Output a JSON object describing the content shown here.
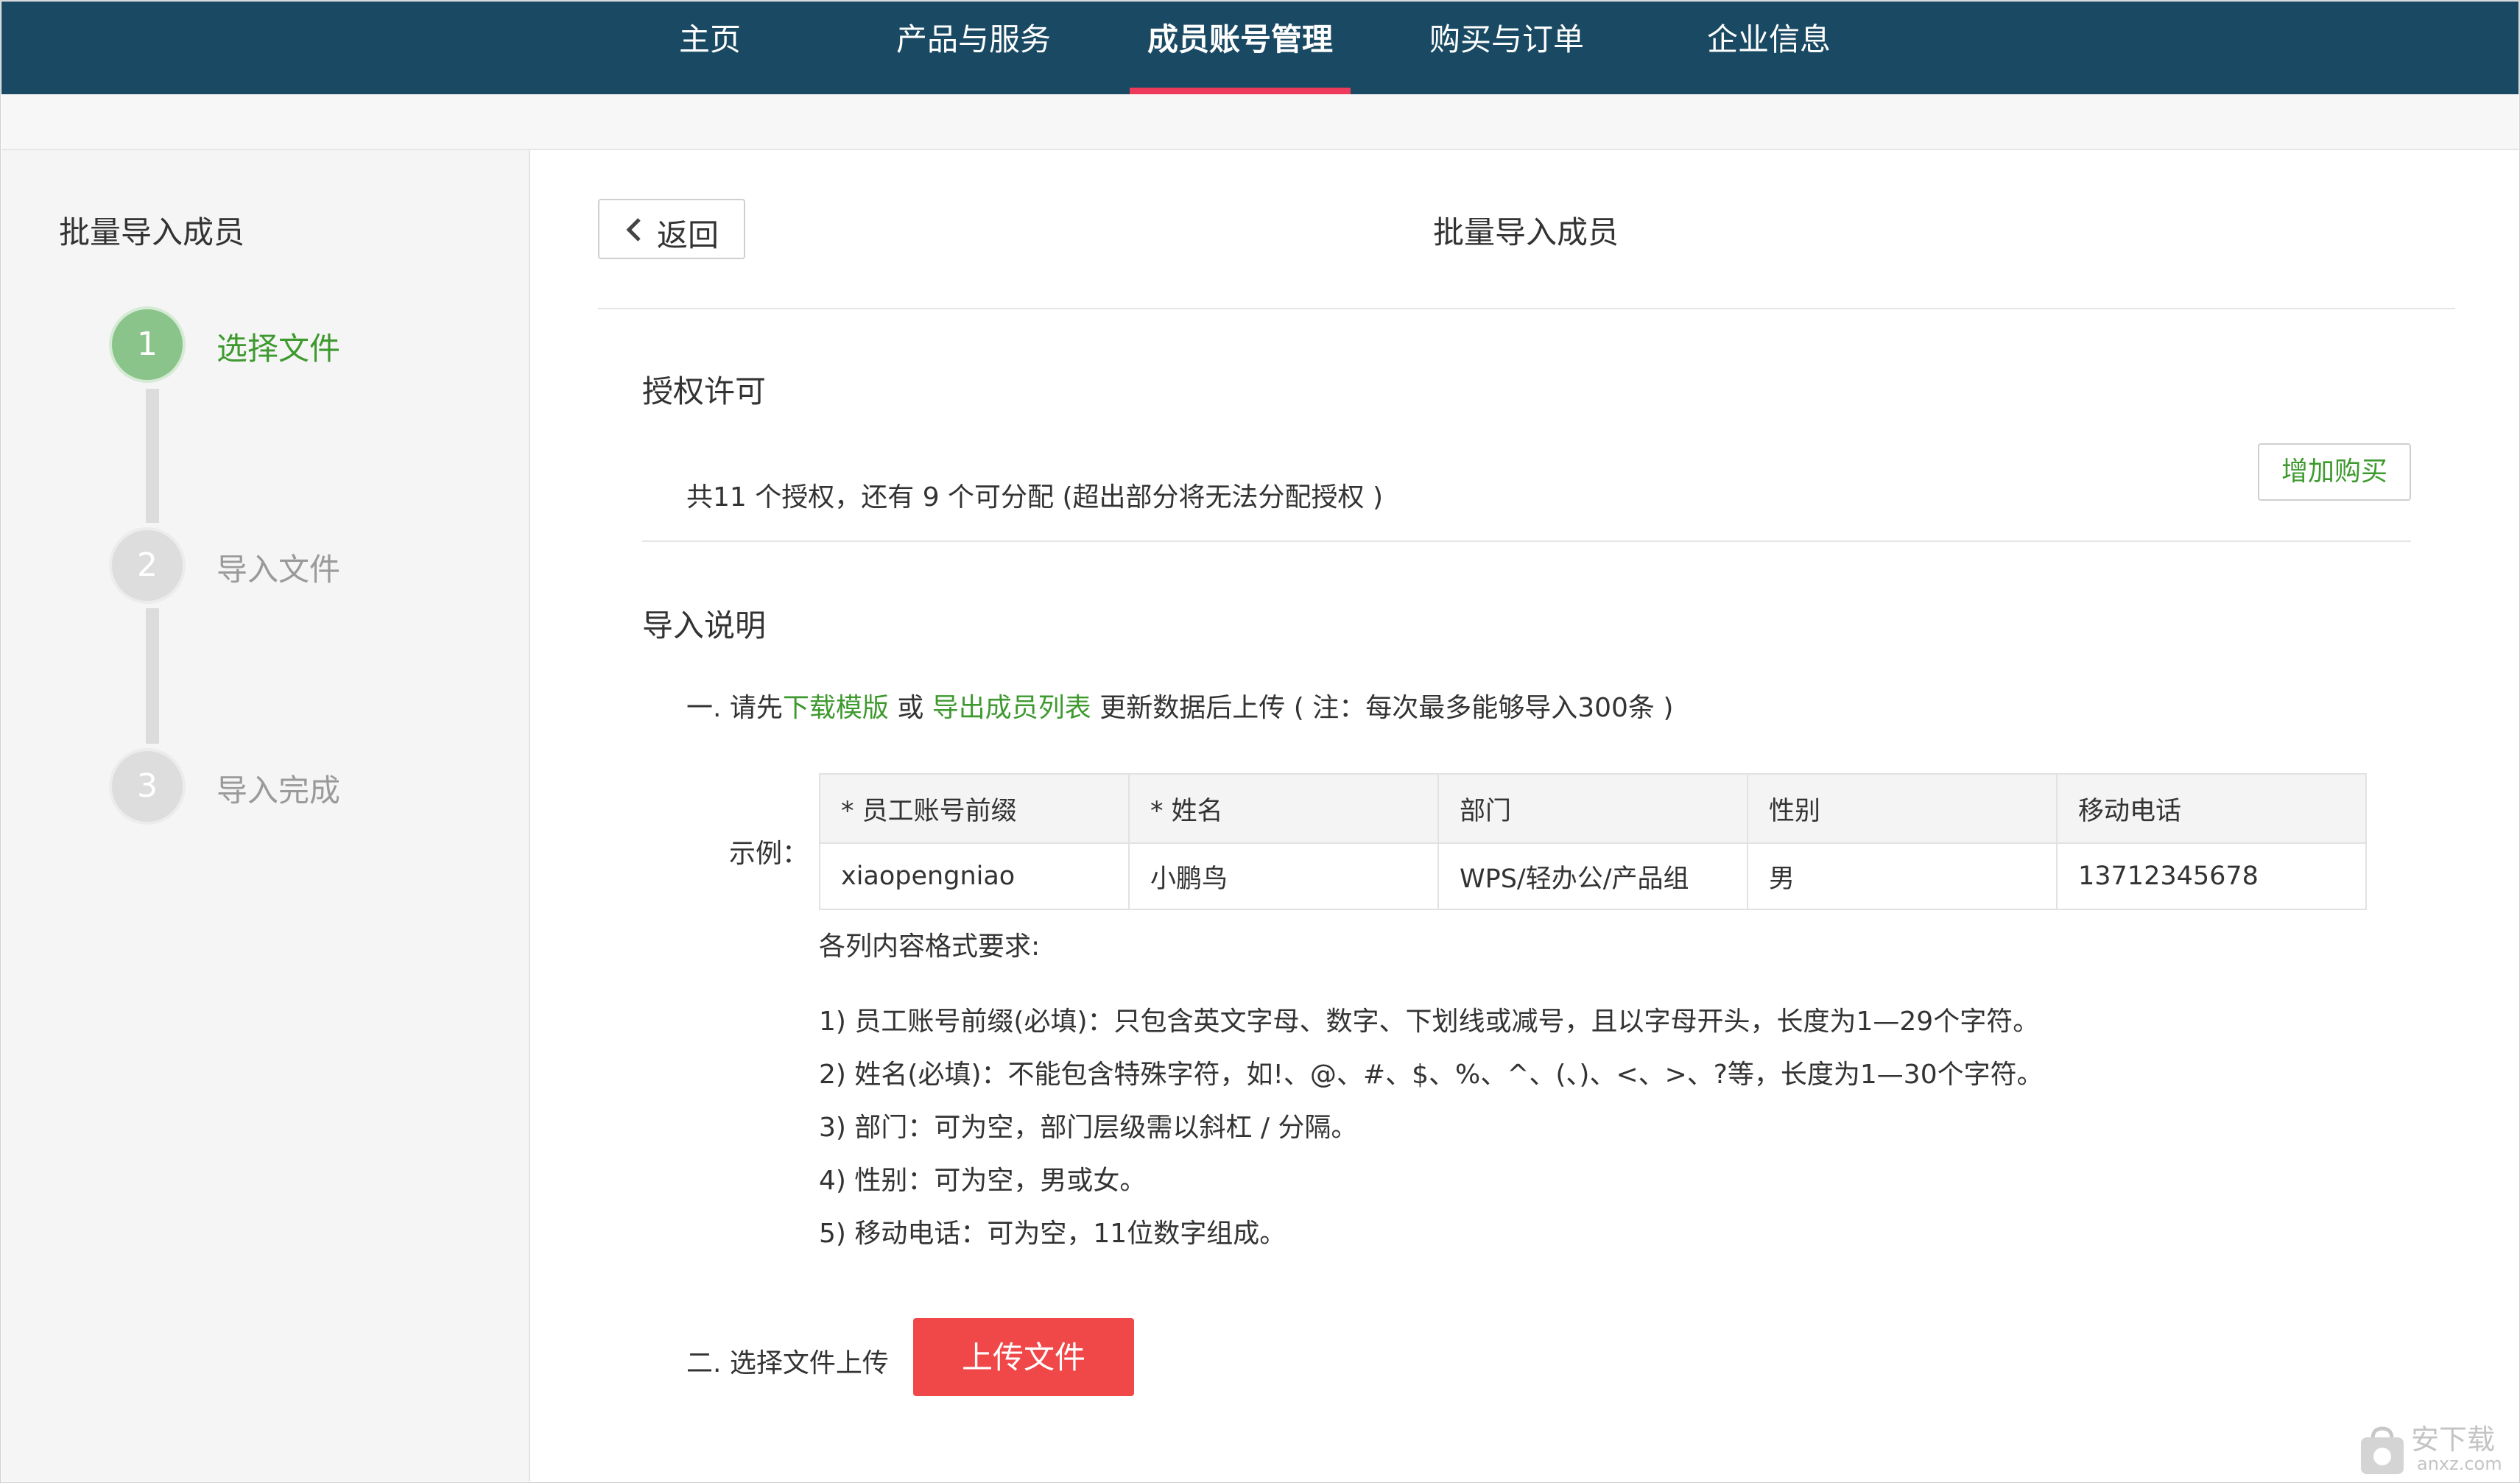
{
  "nav": {
    "items": [
      {
        "label": "主页"
      },
      {
        "label": "产品与服务"
      },
      {
        "label": "成员账号管理"
      },
      {
        "label": "购买与订单"
      },
      {
        "label": "企业信息"
      }
    ],
    "active_index": 2
  },
  "sidebar": {
    "title": "批量导入成员",
    "steps": [
      {
        "num": "1",
        "label": "选择文件",
        "state": "active"
      },
      {
        "num": "2",
        "label": "导入文件",
        "state": "inactive"
      },
      {
        "num": "3",
        "label": "导入完成",
        "state": "inactive"
      }
    ]
  },
  "header": {
    "back_label": "返回",
    "title": "批量导入成员"
  },
  "license": {
    "title": "授权许可",
    "text": "共11 个授权，还有 9 个可分配 (超出部分将无法分配授权 )",
    "buy_label": "增加购买"
  },
  "import_info": {
    "title": "导入说明",
    "step1_prefix": "一. 请先",
    "download_link": "下载模版",
    "or": " 或 ",
    "export_link": "导出成员列表",
    "step1_suffix": " 更新数据后上传 ( 注：每次最多能够导入300条 )",
    "example_label": "示例：",
    "table_headers": [
      "* 员工账号前缀",
      "* 姓名",
      "部门",
      "性别",
      "移动电话"
    ],
    "table_row": [
      "xiaopengniao",
      "小鹏鸟",
      "WPS/轻办公/产品组",
      "男",
      "13712345678"
    ],
    "format_title": "各列内容格式要求:",
    "rules": [
      "1) 员工账号前缀(必填)：只包含英文字母、数字、下划线或减号，且以字母开头，长度为1—29个字符。",
      "2) 姓名(必填)：不能包含特殊字符，如!、@、#、$、%、^、(、)、<、>、?等，长度为1—30个字符。",
      "3) 部门：可为空，部门层级需以斜杠 / 分隔。",
      "4) 性别：可为空，男或女。",
      "5) 移动电话：可为空，11位数字组成。"
    ],
    "step2_label": "二. 选择文件上传",
    "upload_label": "上传文件"
  },
  "watermark": {
    "text": "安下载",
    "url": "anxz.com"
  },
  "colors": {
    "nav_bg": "#1a4a63",
    "nav_active": "#ef3b5b",
    "accent_green": "#3e9a2f",
    "upload_red": "#f04848"
  }
}
